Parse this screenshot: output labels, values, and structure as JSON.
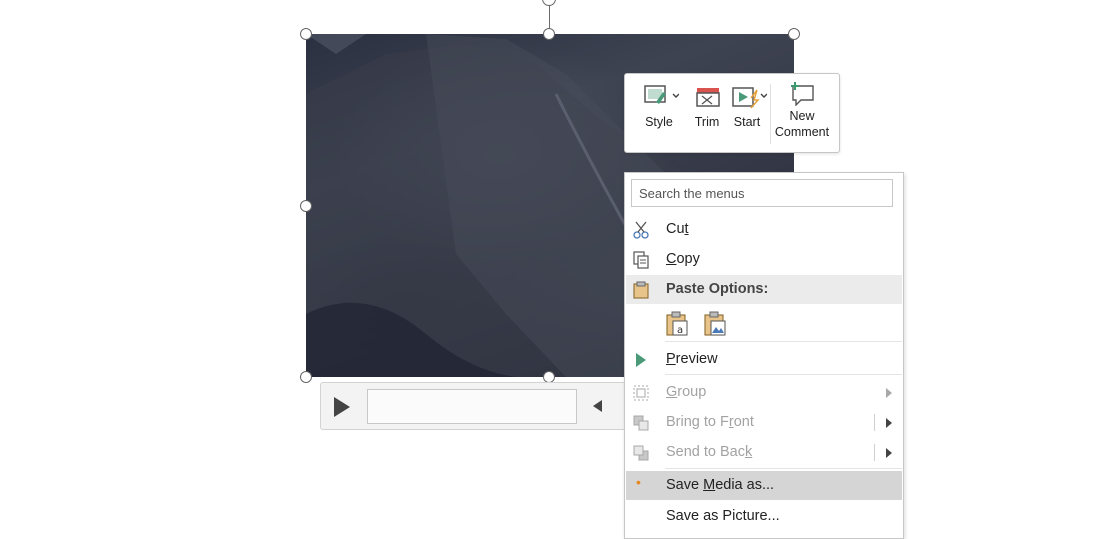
{
  "mini_toolbar": {
    "style_label": "Style",
    "trim_label": "Trim",
    "start_label": "Start",
    "new_comment_line1": "New",
    "new_comment_line2": "Comment"
  },
  "context_menu": {
    "search_placeholder": "Search the menus",
    "items": {
      "cut": {
        "pre": "Cu",
        "key": "t",
        "post": ""
      },
      "copy": {
        "pre": "",
        "key": "C",
        "post": "opy"
      },
      "paste_options": "Paste Options:",
      "preview": {
        "pre": "",
        "key": "P",
        "post": "review"
      },
      "group": {
        "pre": "",
        "key": "G",
        "post": "roup"
      },
      "bring_to_front": {
        "pre": "Bring to F",
        "key": "r",
        "post": "ont"
      },
      "send_to_back": {
        "pre": "Send to Bac",
        "key": "k",
        "post": ""
      },
      "save_media_as": {
        "pre": "Save ",
        "key": "M",
        "post": "edia as..."
      },
      "save_as_picture": {
        "pre": "Save as Picture...",
        "key": "",
        "post": ""
      }
    }
  },
  "colors": {
    "accent_green": "#4a9a7a",
    "trim_red": "#d9534f",
    "comment_green": "#3a9a6a",
    "highlight_row": "#d5d5d5",
    "disabled_text": "#a2a2a2"
  }
}
